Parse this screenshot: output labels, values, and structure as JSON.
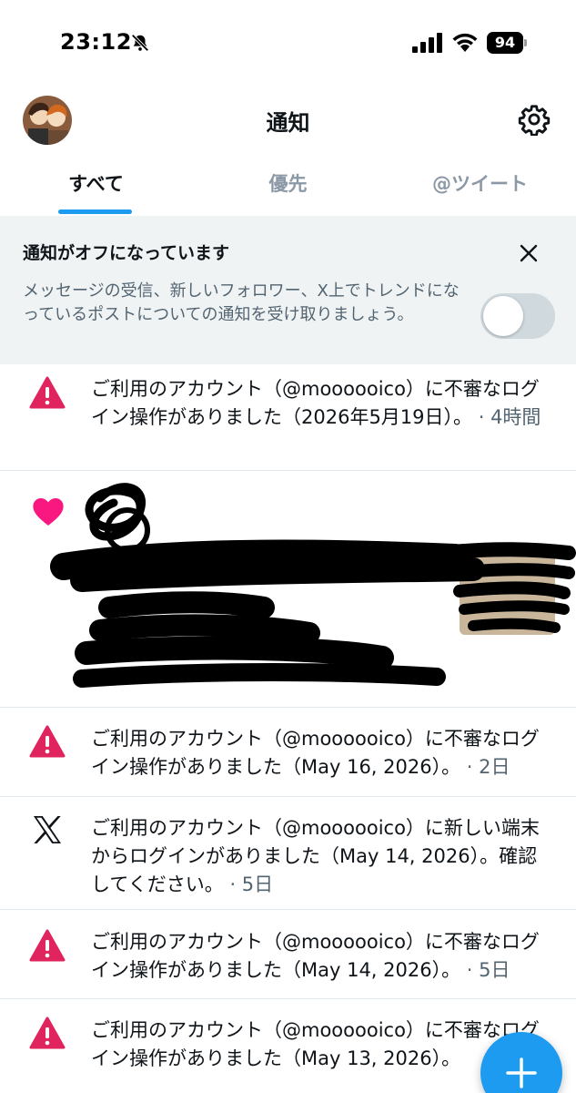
{
  "status_bar": {
    "time": "23:12",
    "battery": "94"
  },
  "header": {
    "title": "通知"
  },
  "tabs": [
    {
      "label": "すべて",
      "active": true
    },
    {
      "label": "優先",
      "active": false
    },
    {
      "label": "@ツイート",
      "active": false
    }
  ],
  "banner": {
    "title": "通知がオフになっています",
    "text": "メッセージの受信、新しいフォロワー、X上でトレンドになっているポストについての通知を受け取りましょう。",
    "toggle_on": false
  },
  "notifications": [
    {
      "icon": "alert-icon",
      "text": "ご利用のアカウント（@moooooico）に不審なログイン操作がありました（2026年5月19日）。",
      "time": "· 4時間"
    },
    {
      "icon": "heart-icon",
      "text": "",
      "time": ""
    },
    {
      "icon": "alert-icon",
      "text": "ご利用のアカウント（@moooooico）に不審なログイン操作がありました（May 16, 2026）。",
      "time": "· 2日"
    },
    {
      "icon": "x-logo-icon",
      "text": "ご利用のアカウント（@moooooico）に新しい端末からログインがありました（May 14, 2026）。確認してください。",
      "time": "· 5日"
    },
    {
      "icon": "alert-icon",
      "text": "ご利用のアカウント（@moooooico）に不審なログイン操作がありました（May 14, 2026）。",
      "time": "· 5日"
    },
    {
      "icon": "alert-icon",
      "text": "ご利用のアカウント（@moooooico）に不審なログイン操作がありました（May 13, 2026）。",
      "time": ""
    }
  ],
  "colors": {
    "accent": "#1d9bf0",
    "alert": "#e0245e",
    "heart": "#f91880",
    "banner_bg": "#eff3f4"
  },
  "icons": {
    "settings": "gear-icon",
    "close": "close-icon",
    "compose": "plus-icon",
    "mute": "bell-off-icon"
  }
}
